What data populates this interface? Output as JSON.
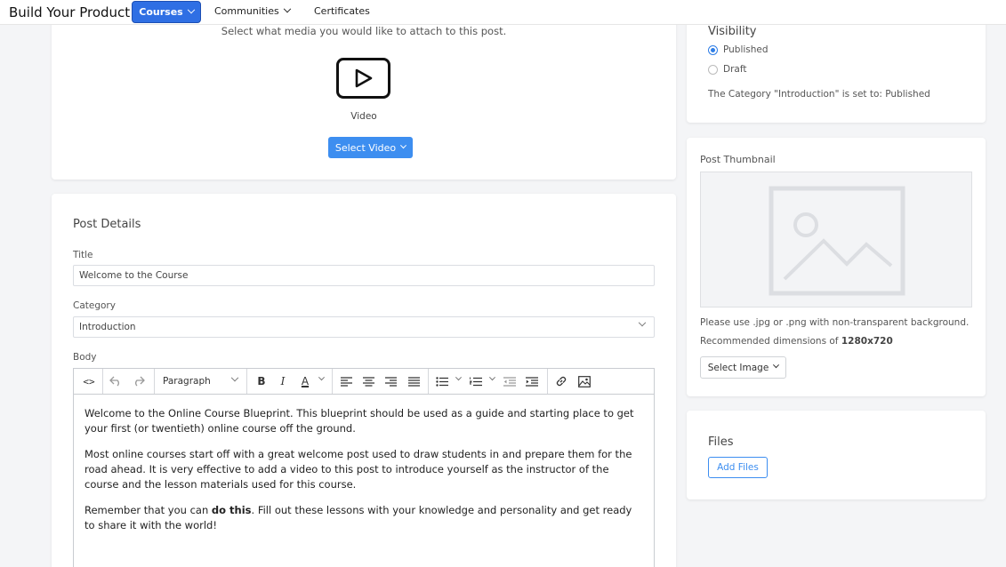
{
  "nav": {
    "brand": "Build Your Product",
    "items": [
      {
        "label": "Courses",
        "active": true
      },
      {
        "label": "Communities"
      },
      {
        "label": "Certificates"
      }
    ]
  },
  "media": {
    "prompt": "Select what media you would like to attach to this post.",
    "type_label": "Video",
    "select_button": "Select Video"
  },
  "post_details": {
    "section_title": "Post Details",
    "title_label": "Title",
    "title_value": "Welcome to the Course",
    "category_label": "Category",
    "category_value": "Introduction",
    "body_label": "Body",
    "toolbar": {
      "paragraph_format": "Paragraph"
    },
    "body_paragraphs": [
      "Welcome to the Online Course Blueprint. This blueprint should be used as a guide and starting place to get your first (or twentieth) online course off the ground.",
      "Most online courses start off with a great welcome post used to draw students in and prepare them for the road ahead. It is very effective to add a video to this post to introduce yourself as the instructor of the course and the lesson materials used for this course."
    ],
    "body_p3_before": "Remember that you can ",
    "body_p3_bold": "do this",
    "body_p3_after": ". Fill out these lessons with your knowledge and personality and get ready to share it with the world!"
  },
  "visibility": {
    "title": "Visibility",
    "options": [
      {
        "label": "Published",
        "checked": true
      },
      {
        "label": "Draft",
        "checked": false
      }
    ],
    "status_text": "The Category \"Introduction\" is set to: Published"
  },
  "thumbnail": {
    "title": "Post Thumbnail",
    "hint": "Please use .jpg or .png with non-transparent background.",
    "dimensions_prefix": "Recommended dimensions of ",
    "dimensions_value": "1280x720",
    "select_button": "Select Image"
  },
  "files": {
    "title": "Files",
    "add_button": "Add Files"
  },
  "colors": {
    "primary": "#2f6fe4",
    "accent": "#3d8ef0"
  }
}
